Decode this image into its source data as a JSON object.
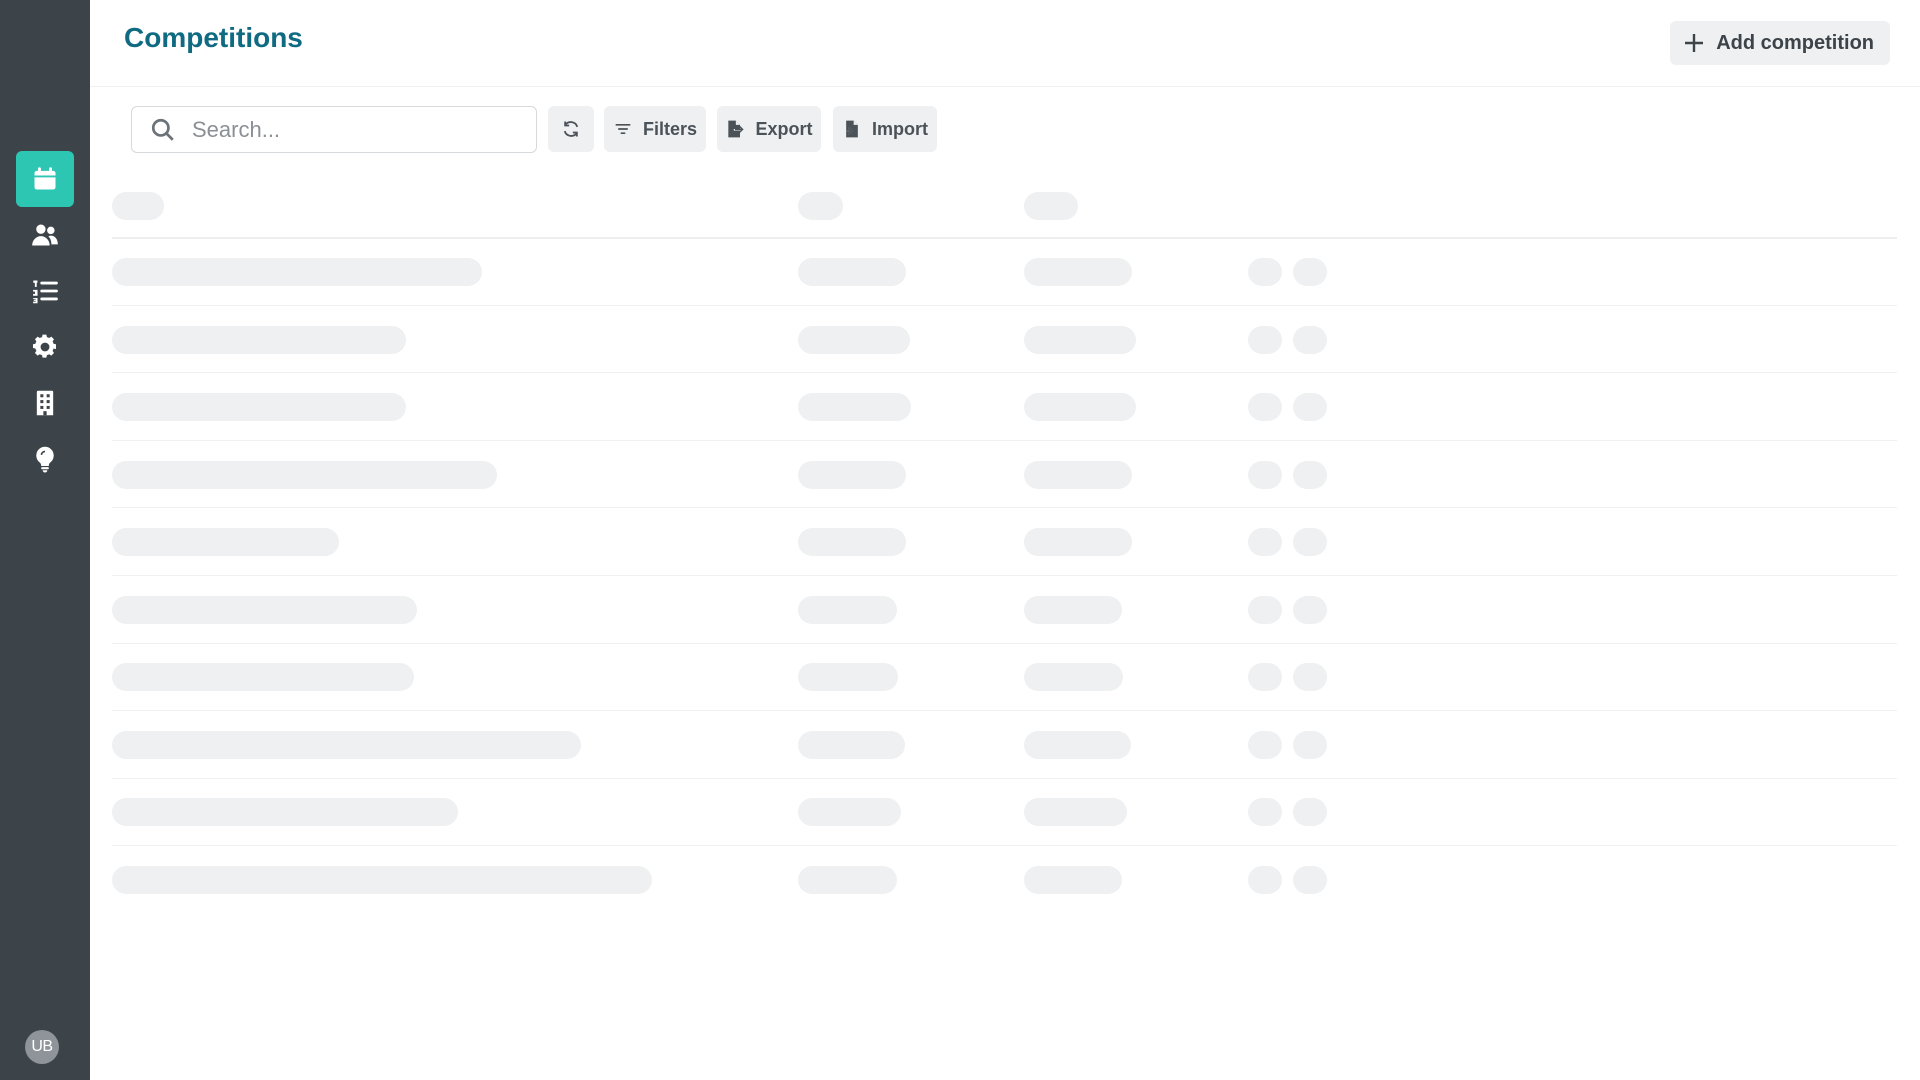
{
  "header": {
    "title": "Competitions",
    "add_button_label": "Add competition"
  },
  "toolbar": {
    "search_placeholder": "Search...",
    "filters_label": "Filters",
    "export_label": "Export",
    "import_label": "Import"
  },
  "sidebar": {
    "items": [
      {
        "name": "calendar-icon",
        "active": true
      },
      {
        "name": "users-icon",
        "active": false
      },
      {
        "name": "ranked-list-icon",
        "active": false
      },
      {
        "name": "gear-icon",
        "active": false
      },
      {
        "name": "building-icon",
        "active": false
      },
      {
        "name": "lightbulb-icon",
        "active": false
      }
    ],
    "avatar_initials": "UB"
  },
  "table": {
    "state": "loading",
    "skeleton_rows": 10
  },
  "colors": {
    "sidebar_bg": "#3d4449",
    "accent": "#2dc6b3",
    "title": "#0f6a82",
    "skeleton": "#eff0f1"
  }
}
